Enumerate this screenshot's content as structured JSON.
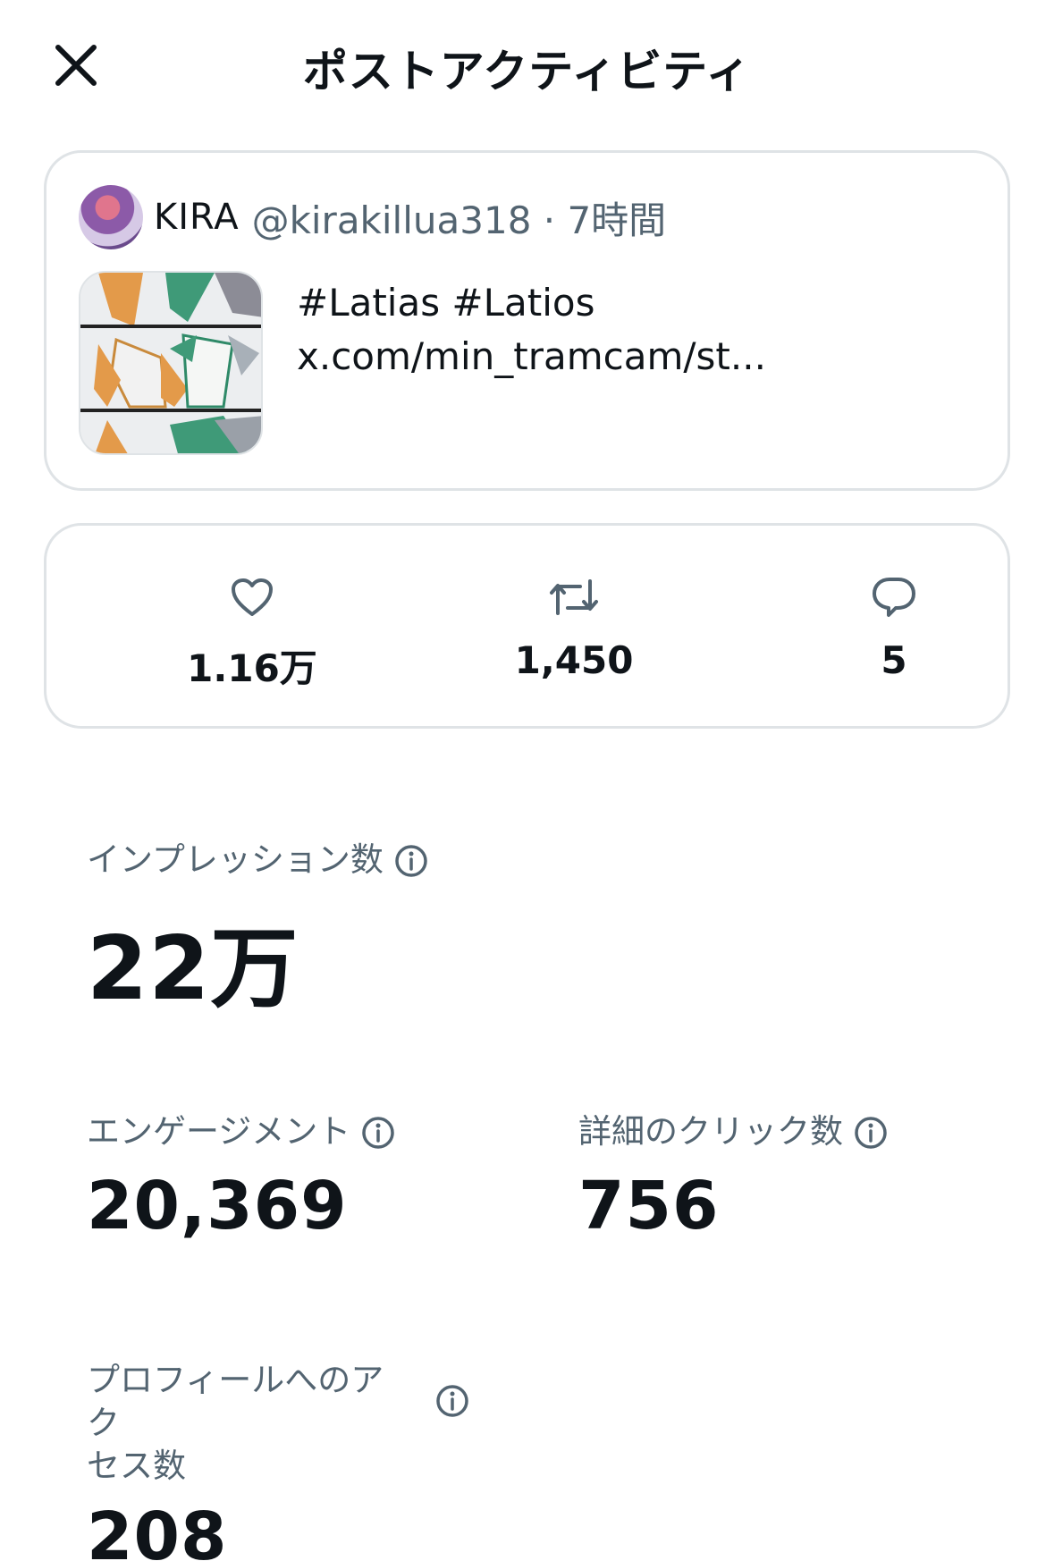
{
  "header": {
    "title": "ポストアクティビティ"
  },
  "post": {
    "display_name": "KIRA",
    "handle_meta": "@kirakillua318 · 7時間",
    "text_line1": "#Latias #Latios",
    "text_line2": "x.com/min_tramcam/st..."
  },
  "stats": {
    "likes": "1.16万",
    "reposts": "1,450",
    "replies": "5"
  },
  "metrics": {
    "impressions_label": "インプレッション数",
    "impressions_value": "22万",
    "engagement_label": "エンゲージメント",
    "engagement_value": "20,369",
    "detail_clicks_label": "詳細のクリック数",
    "detail_clicks_value": "756",
    "profile_visits_label_line1": "プロフィールへのアク",
    "profile_visits_label_line2": "セス数",
    "profile_visits_value": "208"
  },
  "icons": {
    "close": "close-icon",
    "like": "heart-icon",
    "repost": "repost-icon",
    "reply": "reply-icon",
    "info": "info-icon"
  },
  "colors": {
    "text": "#0f1419",
    "secondary": "#536471",
    "border": "#dfe3e6"
  }
}
